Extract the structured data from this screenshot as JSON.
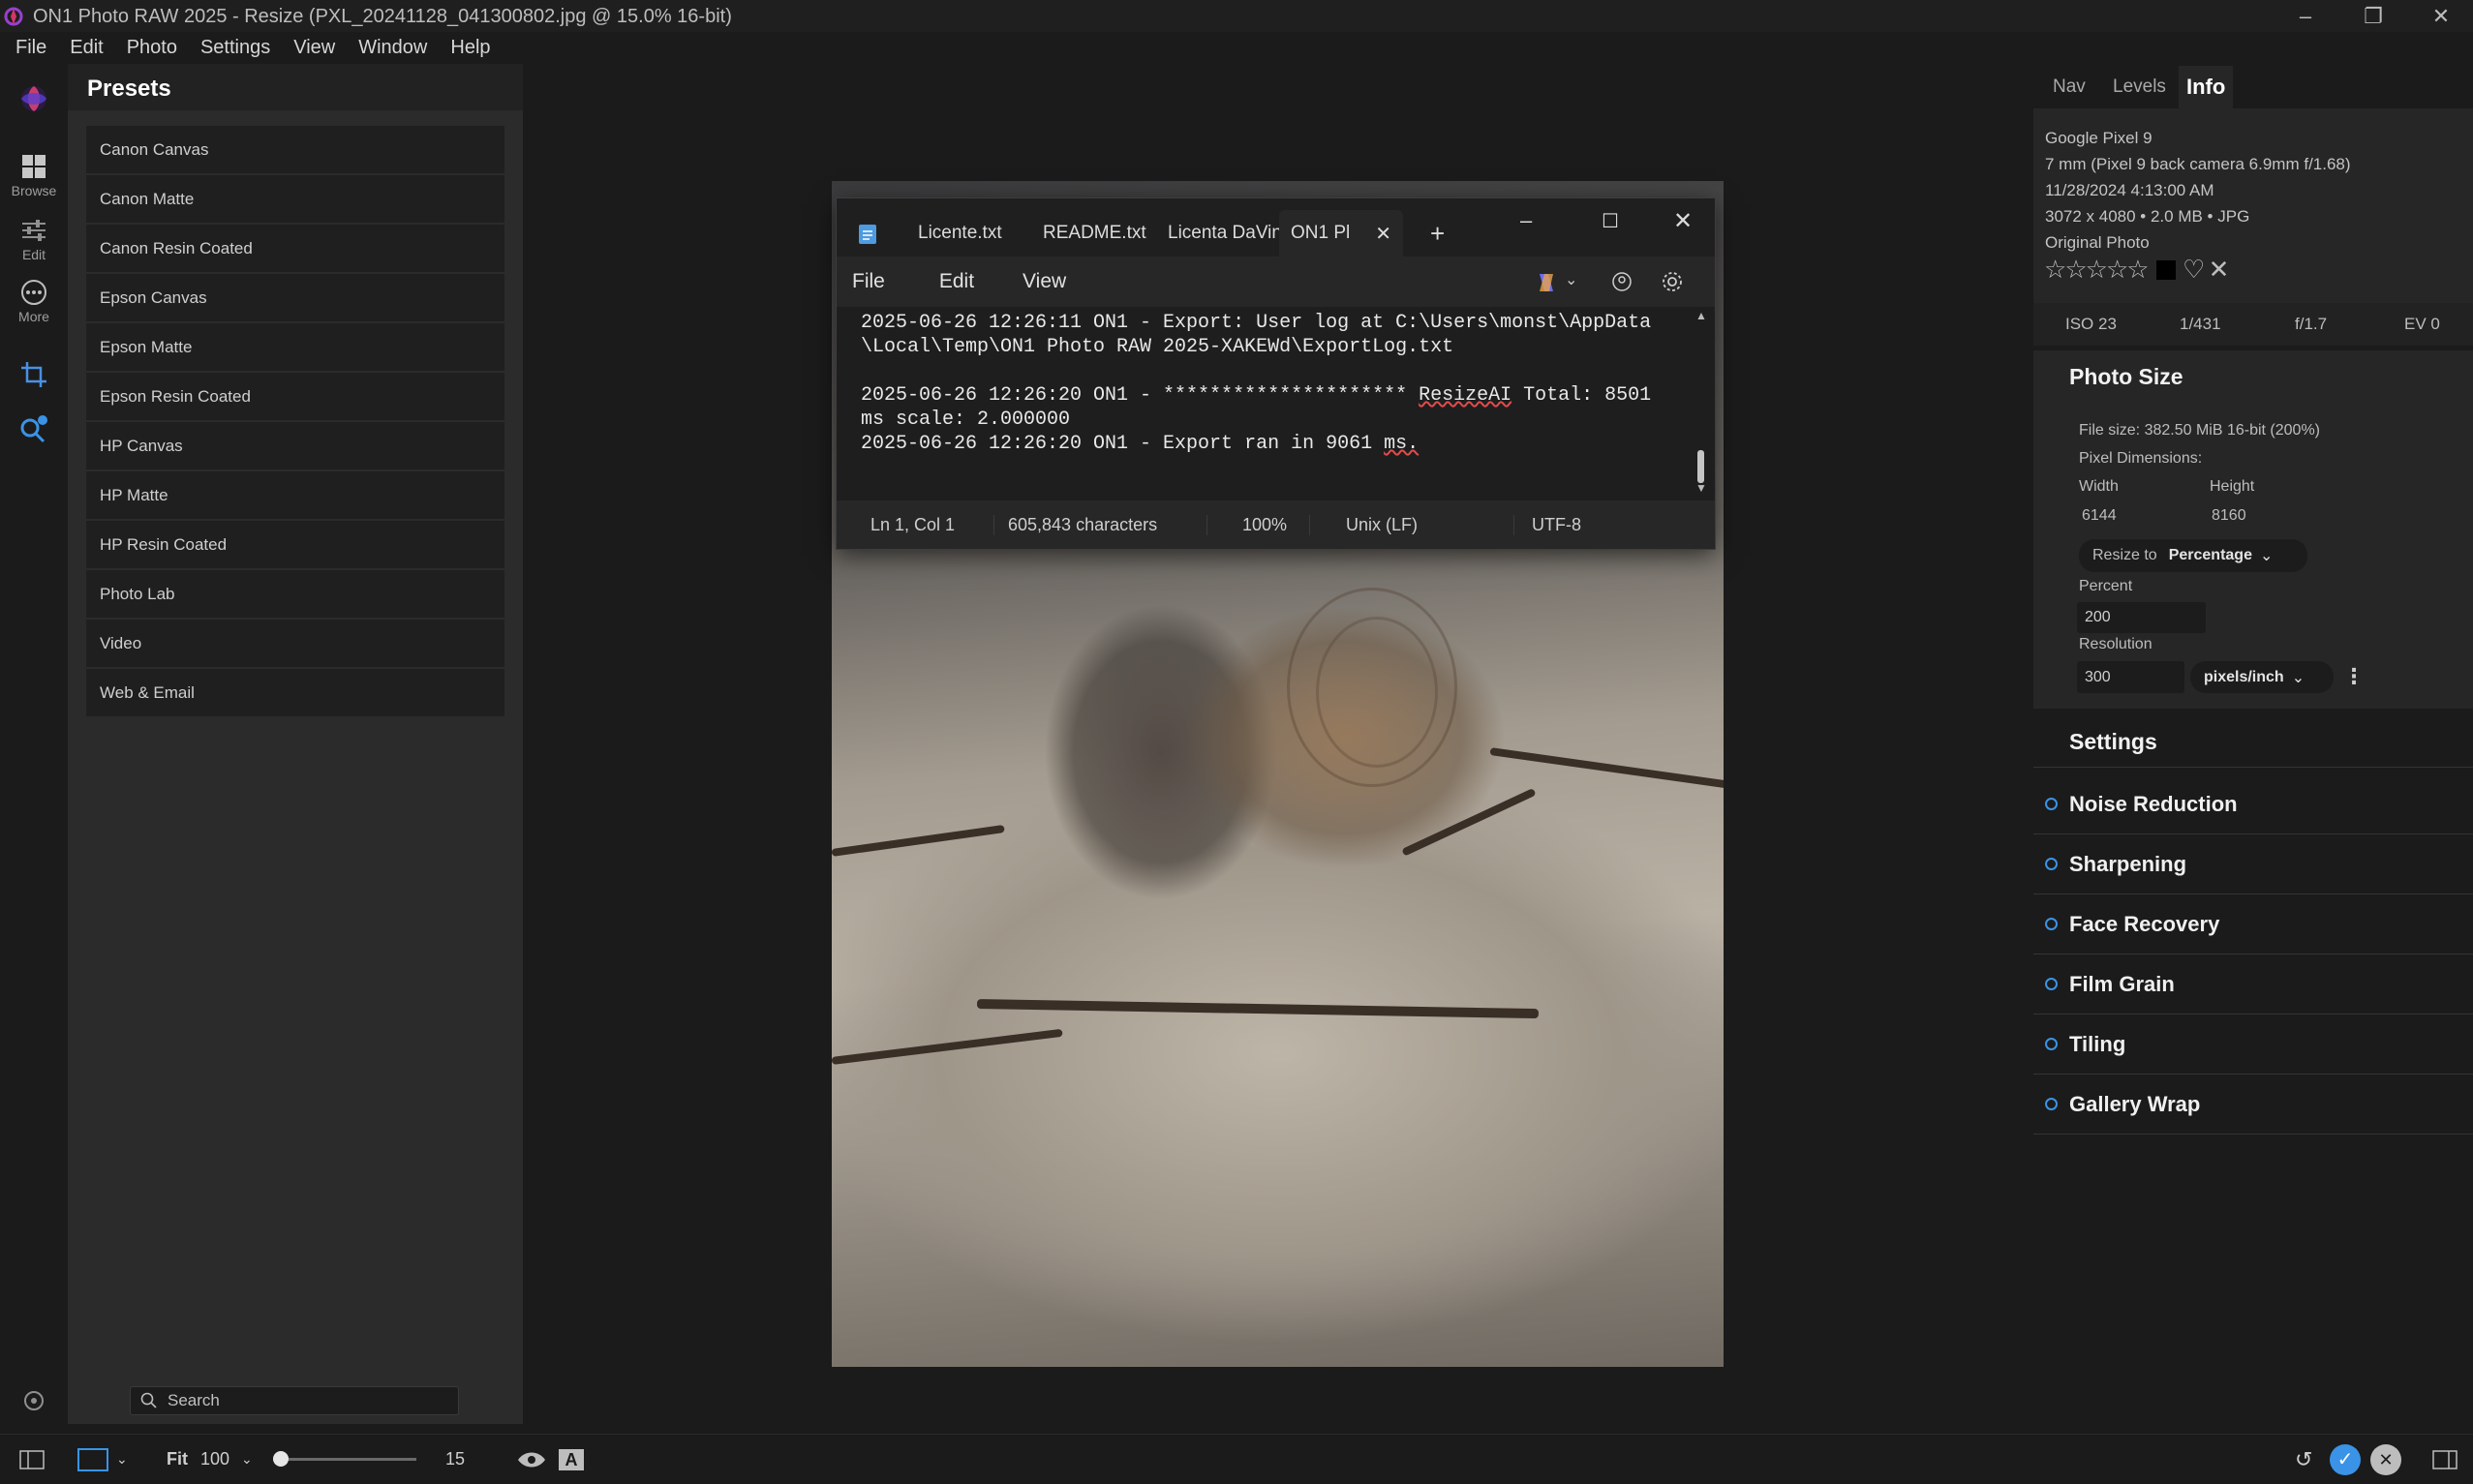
{
  "window": {
    "title": "ON1 Photo RAW 2025 - Resize (PXL_20241128_041300802.jpg @ 15.0% 16-bit)"
  },
  "menu": [
    "File",
    "Edit",
    "Photo",
    "Settings",
    "View",
    "Window",
    "Help"
  ],
  "rail": {
    "browse": "Browse",
    "edit": "Edit",
    "more": "More"
  },
  "presets": {
    "title": "Presets",
    "items": [
      "Canon Canvas",
      "Canon Matte",
      "Canon Resin Coated",
      "Epson Canvas",
      "Epson Matte",
      "Epson Resin Coated",
      "HP Canvas",
      "HP Matte",
      "HP Resin Coated",
      "Photo Lab",
      "Video",
      "Web & Email"
    ],
    "search_placeholder": "Search"
  },
  "notepad": {
    "tabs": [
      "Licente.txt",
      "README.txt",
      "Licenta DaVin",
      "ON1 Pl"
    ],
    "menu": [
      "File",
      "Edit",
      "View"
    ],
    "lines": {
      "l1a": "2025-06-26 12:26:11 ON1 - Export: User log at C:\\Users\\monst\\AppData",
      "l1b": "\\Local\\Temp\\ON1 Photo RAW 2025-XAKEWd\\ExportLog.txt",
      "l2_pre": "2025-06-26 12:26:20 ON1 - ********************* ",
      "l2_word": "ResizeAI",
      "l2_post": " Total: 8501",
      "l3": "ms scale: 2.000000",
      "l4_pre": "2025-06-26 12:26:20 ON1 - Export ran in 9061 ",
      "l4_word": "ms."
    },
    "status": {
      "position": "Ln 1, Col 1",
      "chars": "605,843 characters",
      "zoom": "100%",
      "eol": "Unix (LF)",
      "encoding": "UTF-8"
    }
  },
  "right_tabs": [
    "Nav",
    "Levels",
    "Info"
  ],
  "info": {
    "camera": "Google Pixel 9",
    "lens": "7 mm (Pixel 9 back camera 6.9mm f/1.68)",
    "date": "11/28/2024 4:13:00 AM",
    "dims": "3072 x 4080 • 2.0 MB • JPG",
    "kind": "Original Photo",
    "rating": 0,
    "exif": [
      "ISO 23",
      "1/431",
      "f/1.7",
      "EV 0"
    ]
  },
  "photo_size": {
    "title": "Photo Size",
    "file_size": "File size: 382.50 MiB 16-bit (200%)",
    "pixel_dims_label": "Pixel Dimensions:",
    "width_label": "Width",
    "height_label": "Height",
    "width": "6144",
    "height": "8160",
    "resize_to_label": "Resize to",
    "resize_to_value": "Percentage",
    "percent_label": "Percent",
    "percent": "200",
    "resolution_label": "Resolution",
    "resolution": "300",
    "resolution_unit": "pixels/inch"
  },
  "settings": {
    "title": "Settings",
    "items": [
      "Noise Reduction",
      "Sharpening",
      "Face Recovery",
      "Film Grain",
      "Tiling",
      "Gallery Wrap"
    ]
  },
  "bottom": {
    "fit": "Fit",
    "zoom_value": "100",
    "slider_value": "15",
    "slider_fraction": 0.0
  },
  "colors": {
    "accent": "#3a93e6",
    "panel": "#2b2b2b",
    "background": "#1b1b1b"
  }
}
